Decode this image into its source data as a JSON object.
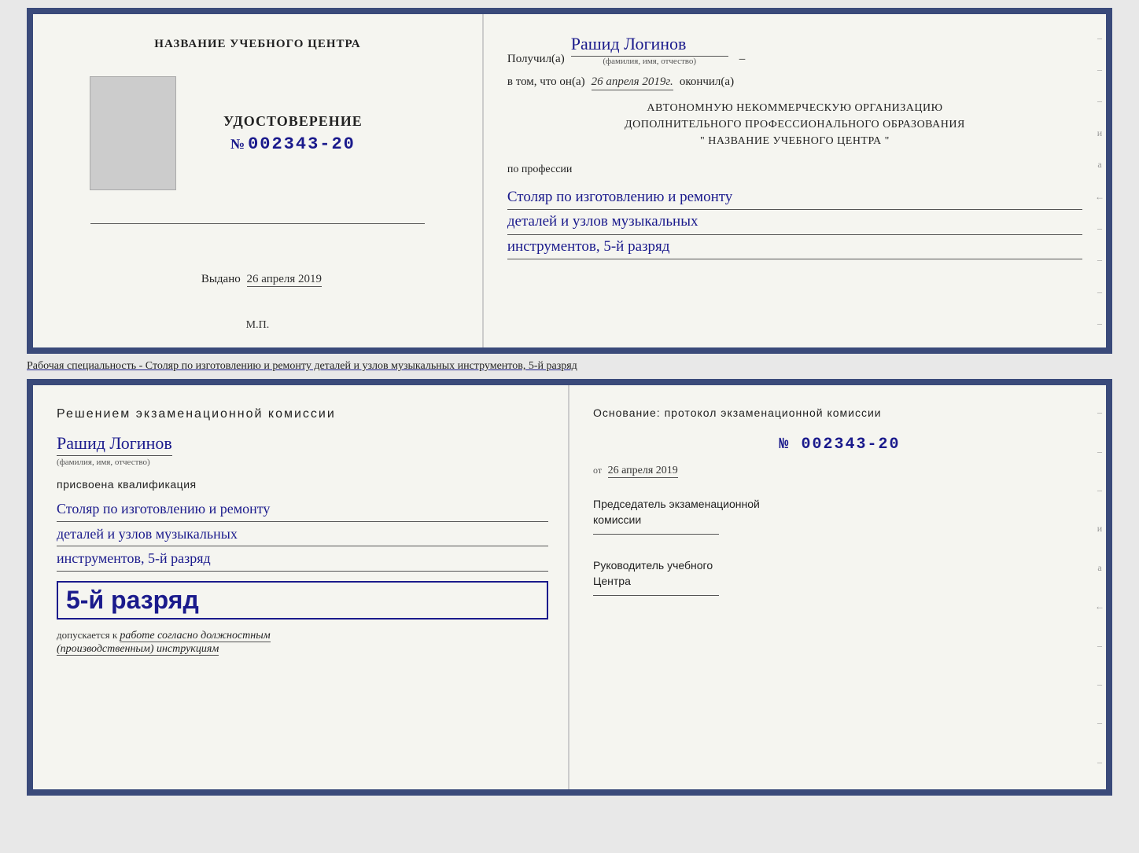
{
  "page": {
    "background": "#e8e8e8"
  },
  "doc_top": {
    "left": {
      "center_title": "НАЗВАНИЕ УЧЕБНОГО ЦЕНТРА",
      "udostoverenie_label": "УДОСТОВЕРЕНИЕ",
      "number_prefix": "№",
      "number": "002343-20",
      "vydano_label": "Выдано",
      "vydano_date": "26 апреля 2019",
      "mp_label": "М.П."
    },
    "right": {
      "poluchil_label": "Получил(а)",
      "poluchil_name": "Рашид Логинов",
      "fio_label": "(фамилия, имя, отчество)",
      "vtom_label": "в том, что он(а)",
      "vtom_date": "26 апреля 2019г.",
      "okonchil_label": "окончил(а)",
      "org_line1": "АВТОНОМНУЮ НЕКОММЕРЧЕСКУЮ ОРГАНИЗАЦИЮ",
      "org_line2": "ДОПОЛНИТЕЛЬНОГО ПРОФЕССИОНАЛЬНОГО ОБРАЗОВАНИЯ",
      "org_name": "\"  НАЗВАНИЕ УЧЕБНОГО ЦЕНТРА  \"",
      "po_professii_label": "по профессии",
      "profession_line1": "Столяр по изготовлению и ремонту",
      "profession_line2": "деталей и узлов музыкальных",
      "profession_line3": "инструментов, 5-й разряд"
    }
  },
  "separator": {
    "text": "Рабочая специальность - Столяр по изготовлению и ремонту деталей и узлов музыкальных инструментов, 5-й разряд"
  },
  "doc_bottom": {
    "left": {
      "decision_title": "Решением  экзаменационной  комиссии",
      "person_name": "Рашид Логинов",
      "fio_label": "(фамилия, имя, отчество)",
      "prisvoena_label": "присвоена квалификация",
      "qualification_line1": "Столяр по изготовлению и ремонту",
      "qualification_line2": "деталей и узлов музыкальных",
      "qualification_line3": "инструментов, 5-й разряд",
      "razryad_badge": "5-й разряд",
      "dopuskaetsya_prefix": "допускается к",
      "dopuskaetsya_text": "работе согласно должностным",
      "dopuskaetsya_text2": "(производственным) инструкциям"
    },
    "right": {
      "osnov_label": "Основание: протокол экзаменационной  комиссии",
      "number_prefix": "№",
      "number": "002343-20",
      "ot_prefix": "от",
      "ot_date": "26 апреля 2019",
      "predsedatel_label": "Председатель экзаменационной",
      "predsedatel_label2": "комиссии",
      "rukovoditel_label": "Руководитель учебного",
      "rukovoditel_label2": "Центра"
    },
    "deco_right": {
      "chars": [
        "–",
        "–",
        "–",
        "и",
        "а",
        "←",
        "–",
        "–",
        "–",
        "–"
      ]
    }
  }
}
